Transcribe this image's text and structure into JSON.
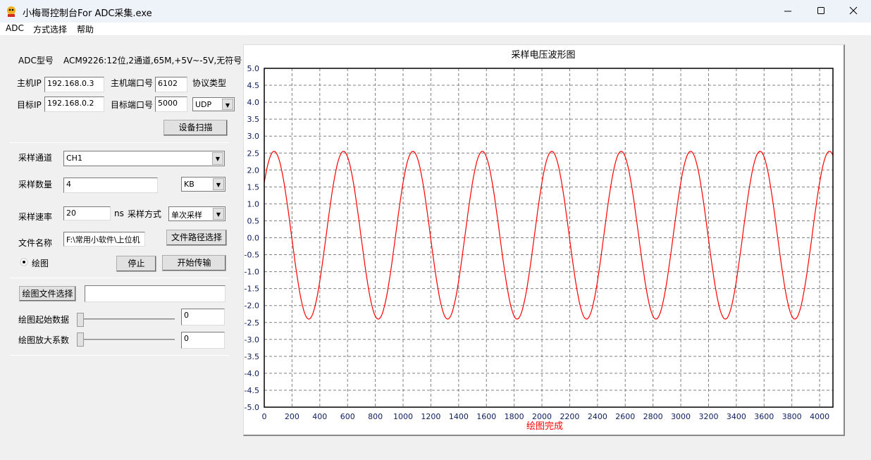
{
  "window": {
    "title": "小梅哥控制台For ADC采集.exe",
    "icon": "app-mascot-icon",
    "controls": [
      "minimize-icon",
      "maximize-icon",
      "close-icon"
    ]
  },
  "menu": [
    "ADC",
    "方式选择",
    "帮助"
  ],
  "config": {
    "adc_model_label": "ADC型号",
    "adc_model_value": "ACM9226:12位,2通道,65M,+5V~-5V,无符号",
    "host_ip_label": "主机IP",
    "host_ip": "192.168.0.3",
    "host_port_label": "主机端口号",
    "host_port": "6102",
    "protocol_label": "协议类型",
    "protocol": "UDP",
    "target_ip_label": "目标IP",
    "target_ip": "192.168.0.2",
    "target_port_label": "目标端口号",
    "target_port": "5000",
    "scan_button": "设备扫描"
  },
  "sampling": {
    "channel_label": "采样通道",
    "channel": "CH1",
    "count_label": "采样数量",
    "count": "4",
    "count_unit": "KB",
    "rate_label": "采样速率",
    "rate": "20",
    "rate_unit": "ns",
    "mode_label": "采样方式",
    "mode": "单次采样",
    "file_label": "文件名称",
    "file": "F:\\常用小软件\\上位机",
    "file_button": "文件路径选择",
    "plot_radio": "绘图",
    "plot_radio_checked": true,
    "stop_button": "停止",
    "start_button": "开始传输"
  },
  "plotting": {
    "file_button": "绘图文件选择",
    "file": "",
    "start_label": "绘图起始数据",
    "start_value": "0",
    "start_slider": 0,
    "scale_label": "绘图放大系数",
    "scale_value": "0",
    "scale_slider": 0
  },
  "status": "绘图完成",
  "colors": {
    "curve": "#ff0000",
    "status": "#ff0000",
    "grid": "#808080"
  },
  "chart_data": {
    "type": "line",
    "title": "采样电压波形图",
    "xlim": [
      0,
      4096
    ],
    "ylim": [
      -5.0,
      5.0
    ],
    "xticks": [
      "0",
      "200",
      "400",
      "600",
      "800",
      "1000",
      "1200",
      "1400",
      "1600",
      "1800",
      "2000",
      "2200",
      "2400",
      "2600",
      "2800",
      "3000",
      "3200",
      "3400",
      "3600",
      "3800",
      "4000"
    ],
    "yticks": [
      "5.0",
      "4.5",
      "4.0",
      "3.5",
      "3.0",
      "2.5",
      "2.0",
      "1.5",
      "1.0",
      "0.5",
      "0.0",
      "-0.5",
      "-1.0",
      "-1.5",
      "-2.0",
      "-2.5",
      "-3.0",
      "-3.5",
      "-4.0",
      "-4.5",
      "-5.0"
    ],
    "grid": true,
    "series": [
      {
        "shape": "sine",
        "max": 2.55,
        "min": -2.4,
        "period": 500,
        "first_peak_x": 71
      }
    ]
  }
}
